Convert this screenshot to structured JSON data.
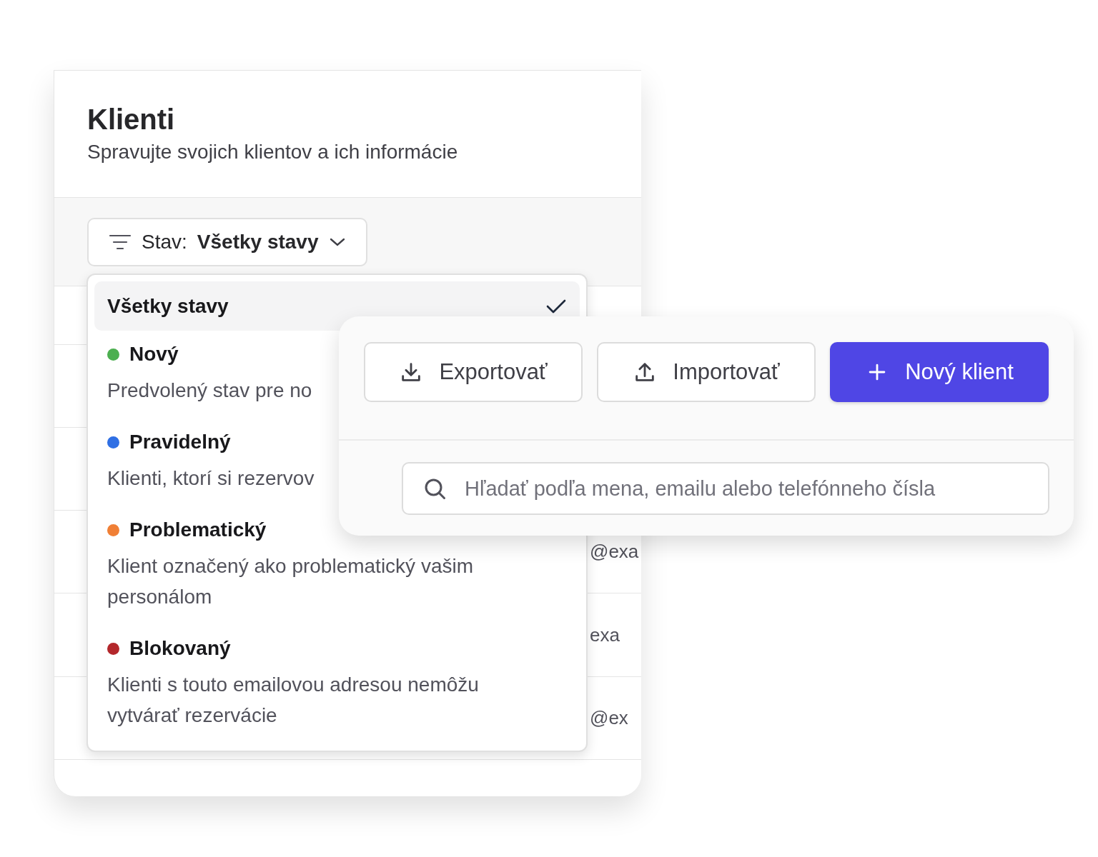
{
  "card": {
    "title": "Klienti",
    "subtitle": "Spravujte svojich klientov a ich informácie",
    "filter": {
      "label": "Stav:",
      "value": "Všetky stavy",
      "expanded": true
    },
    "rows": [
      {},
      {},
      {},
      {
        "column_2": "@exa"
      },
      {
        "column_2": "exa"
      },
      {
        "column_2": "@ex"
      },
      {}
    ]
  },
  "status_menu": [
    {
      "label": "Všetky stavy",
      "selected": true
    },
    {
      "label": "Nový",
      "description": "Predvolený stav pre no",
      "color": "#4caf50",
      "selected": false
    },
    {
      "label": "Pravidelný",
      "description": "Klienti, ktorí si rezervov",
      "color": "#2f6fe4",
      "selected": false
    },
    {
      "label": "Problematický",
      "description": "Klient označený ako problematický vašim personálom",
      "color": "#f07f35",
      "selected": false
    },
    {
      "label": "Blokovaný",
      "description": "Klienti s touto emailovou adresou nemôžu vytvárať rezervácie",
      "color": "#b3272b",
      "selected": false
    }
  ],
  "toolbar": {
    "buttons": [
      {
        "kind": "export",
        "label": "Exportovať"
      },
      {
        "kind": "import",
        "label": "Importovať"
      },
      {
        "kind": "new",
        "label": "Nový klient"
      }
    ],
    "search": {
      "placeholder": "Hľadať podľa mena, emailu alebo telefónneho čísla"
    }
  }
}
